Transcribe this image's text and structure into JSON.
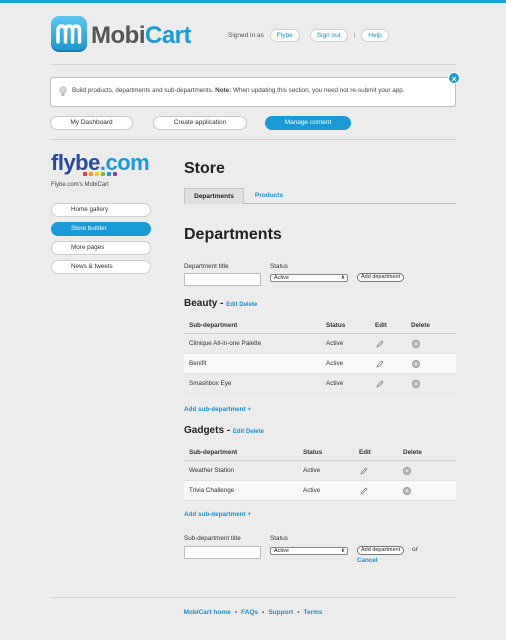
{
  "brand": {
    "logo_mobi": "Mobi",
    "logo_cart": "Cart"
  },
  "header": {
    "signed_in_as": "Signed in as",
    "user": "Flybe",
    "sign_out": "Sign out",
    "separator": "|",
    "help": "Help"
  },
  "notice": {
    "text_before": "Build products, departments and sub-departments. ",
    "note_label": "Note:",
    "text_after": " When updating this section, you need not re-submit your app.",
    "close": "×"
  },
  "top_nav": {
    "dashboard": "My Dashboard",
    "create": "Create application",
    "manage": "Manage content"
  },
  "sidebar": {
    "logo_fly": "flybe",
    "logo_com": ".com",
    "subtitle": "Flybe.com's MobiCart",
    "items": [
      {
        "label": "Home gallery"
      },
      {
        "label": "Store builder"
      },
      {
        "label": "More pages"
      },
      {
        "label": "News & tweets"
      }
    ]
  },
  "main": {
    "title": "Store",
    "tabs": [
      {
        "label": "Departments"
      },
      {
        "label": "Products"
      }
    ],
    "departments_title": "Departments",
    "dept_form": {
      "title_label": "Department title",
      "status_label": "Status",
      "status_value": "Active",
      "add_button": "Add department"
    },
    "columns": {
      "sub": "Sub-department",
      "status": "Status",
      "edit": "Edit",
      "delete": "Delete"
    },
    "groups": [
      {
        "name": "Beauty",
        "dash": " - ",
        "edit": "Edit",
        "delete": "Delete",
        "rows": [
          {
            "name": "Clinique All-in-one Palette",
            "status": "Active"
          },
          {
            "name": "Benifit",
            "status": "Active"
          },
          {
            "name": "Smashbox Eye",
            "status": "Active"
          }
        ],
        "add_link": "Add sub-department +"
      },
      {
        "name": "Gadgets",
        "dash": " - ",
        "edit": "Edit",
        "delete": "Delete",
        "rows": [
          {
            "name": "Weather Station",
            "status": "Active"
          },
          {
            "name": "Trivia Challenge",
            "status": "Active"
          }
        ],
        "add_link": "Add sub-department +"
      }
    ],
    "sub_form": {
      "title_label": "Sub-department title",
      "status_label": "Status",
      "status_value": "Active",
      "add_button": "Add department",
      "or": "or",
      "cancel": "Cancel"
    }
  },
  "footer": {
    "links": [
      "MobiCart home",
      "FAQs",
      "Support",
      "Terms"
    ],
    "separator": "•"
  },
  "colors": {
    "accent": "#1a9bd7",
    "flybe_navy": "#2a4b9b"
  },
  "icons": {
    "edit": "pencil-icon",
    "delete": "delete-x-icon",
    "tip": "lightbulb-icon",
    "close": "close-icon"
  }
}
